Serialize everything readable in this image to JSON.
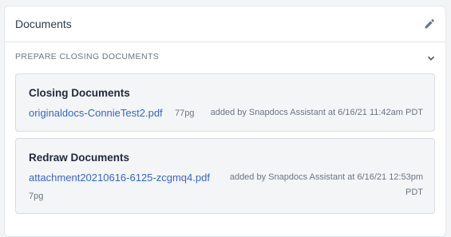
{
  "panel": {
    "title": "Documents",
    "edit_icon": "pencil-icon"
  },
  "section": {
    "title": "PREPARE CLOSING DOCUMENTS",
    "toggle_icon": "chevron-down-icon"
  },
  "cards": [
    {
      "title": "Closing Documents",
      "file_name": "originaldocs-ConnieTest2.pdf",
      "pages": "77pg",
      "added_by": "added by Snapdocs Assistant at 6/16/21 11:42am PDT"
    },
    {
      "title": "Redraw Documents",
      "file_name": "attachment20210616-6125-zcgmq4.pdf",
      "pages": "7pg",
      "added_by_line1": "added by Snapdocs Assistant at 6/16/21 12:53pm",
      "added_by_line2": "PDT"
    }
  ],
  "colors": {
    "link": "#3a66c5",
    "card_background": "#f4f5f7",
    "border": "#d8dde3"
  }
}
